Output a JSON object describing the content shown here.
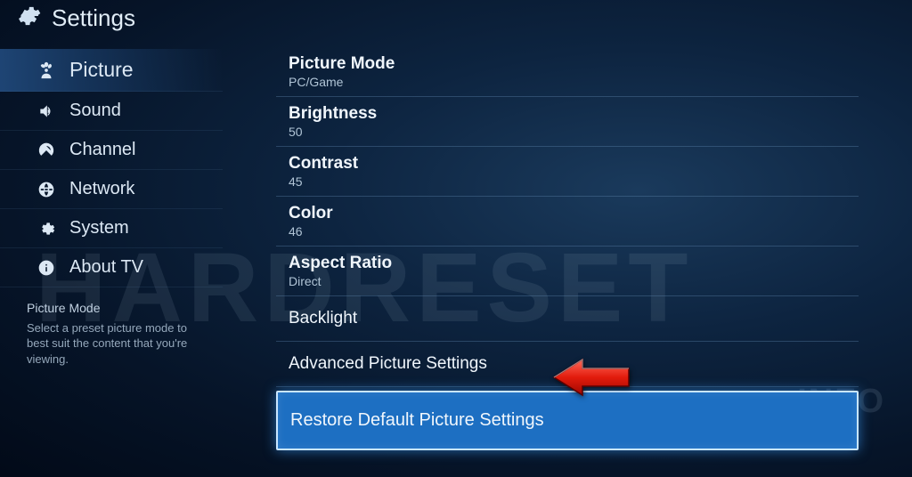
{
  "header": {
    "title": "Settings"
  },
  "sidebar": {
    "items": [
      {
        "label": "Picture",
        "icon": "flower-icon",
        "active": true
      },
      {
        "label": "Sound",
        "icon": "speaker-icon"
      },
      {
        "label": "Channel",
        "icon": "satellite-icon"
      },
      {
        "label": "Network",
        "icon": "globe-icon"
      },
      {
        "label": "System",
        "icon": "cog-icon"
      },
      {
        "label": "About TV",
        "icon": "info-icon"
      }
    ]
  },
  "help": {
    "title": "Picture Mode",
    "body": "Select a preset picture mode to best suit the content that you're viewing."
  },
  "settings": [
    {
      "label": "Picture Mode",
      "value": "PC/Game"
    },
    {
      "label": "Brightness",
      "value": "50"
    },
    {
      "label": "Contrast",
      "value": "45"
    },
    {
      "label": "Color",
      "value": "46"
    },
    {
      "label": "Aspect Ratio",
      "value": "Direct"
    },
    {
      "label": "Backlight",
      "value": ""
    },
    {
      "label": "Advanced Picture Settings",
      "value": ""
    },
    {
      "label": "Restore Default Picture Settings",
      "value": "",
      "selected": true
    }
  ],
  "watermark": {
    "main": "HARDRESET",
    "sub": ".INFO"
  }
}
